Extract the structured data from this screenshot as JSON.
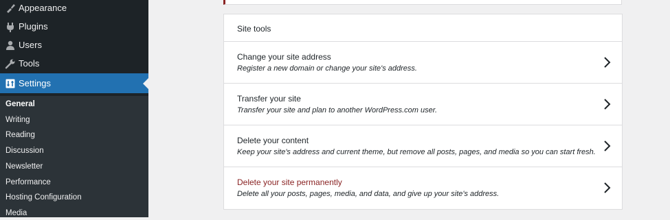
{
  "sidebar": {
    "menu": [
      {
        "label": "Appearance",
        "icon": "paintbrush-icon"
      },
      {
        "label": "Plugins",
        "icon": "plug-icon"
      },
      {
        "label": "Users",
        "icon": "user-icon"
      },
      {
        "label": "Tools",
        "icon": "wrench-icon"
      },
      {
        "label": "Settings",
        "icon": "settings-icon",
        "active": true
      }
    ],
    "submenu": [
      {
        "label": "General",
        "current": true
      },
      {
        "label": "Writing"
      },
      {
        "label": "Reading"
      },
      {
        "label": "Discussion"
      },
      {
        "label": "Newsletter"
      },
      {
        "label": "Performance"
      },
      {
        "label": "Hosting Configuration"
      },
      {
        "label": "Media"
      }
    ]
  },
  "site_tools": {
    "title": "Site tools",
    "items": [
      {
        "title": "Change your site address",
        "description": "Register a new domain or change your site's address."
      },
      {
        "title": "Transfer your site",
        "description": "Transfer your site and plan to another WordPress.com user."
      },
      {
        "title": "Delete your content",
        "description": "Keep your site's address and current theme, but remove all posts, pages, and media so you can start fresh."
      },
      {
        "title": "Delete your site permanently",
        "description": "Delete all your posts, pages, media, and data, and give up your site's address."
      }
    ]
  },
  "colors": {
    "sidebar_bg": "#1d2327",
    "submenu_bg": "#2c3338",
    "active_bg": "#2271b1",
    "danger": "#8a2424",
    "page_bg": "#f0f0f1"
  }
}
